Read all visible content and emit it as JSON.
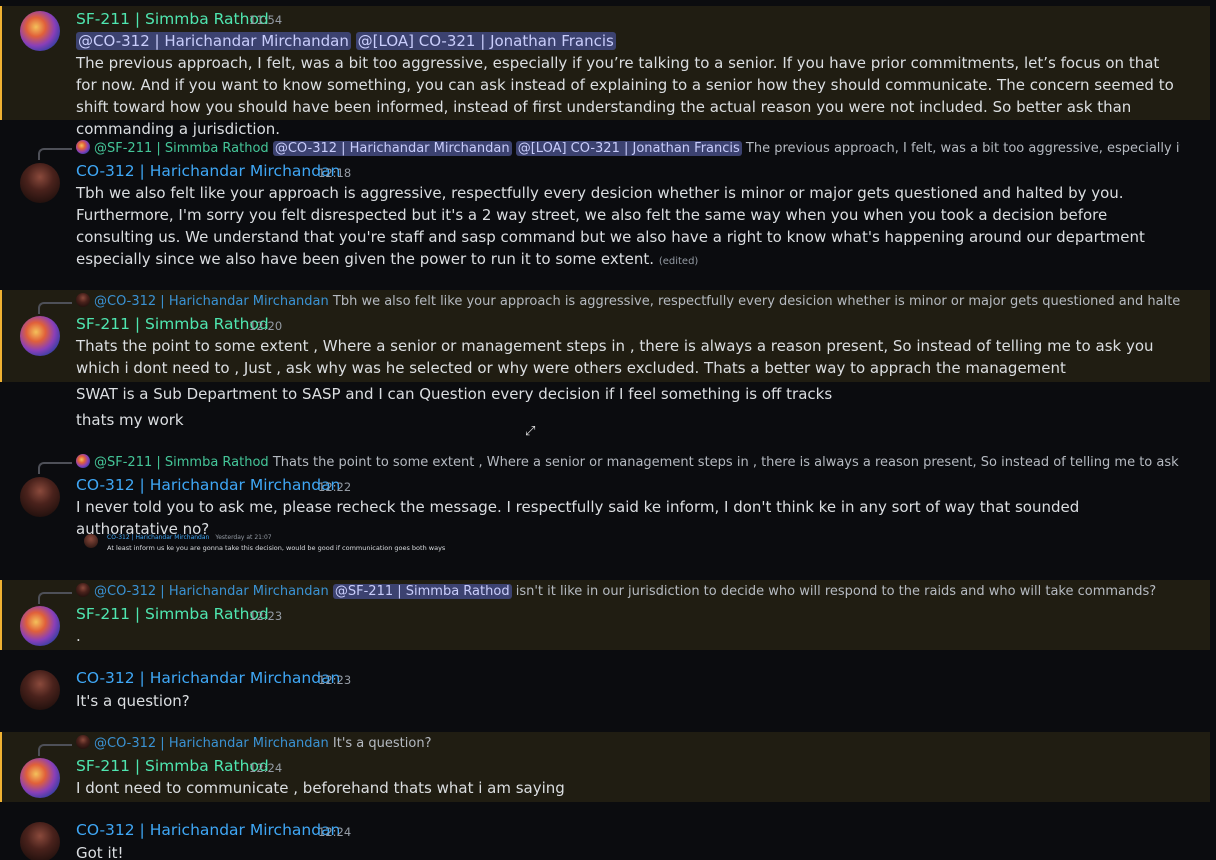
{
  "messages": [
    {
      "author": "SF-211 | Simmba Rathod",
      "time": "11:54",
      "mentions": [
        "@CO-312 | Harichandar Mirchandan",
        "@[LOA] CO-321 | Jonathan Francis"
      ],
      "text": "The previous approach, I felt, was a bit too aggressive, especially if you’re talking to a senior. If you have prior commitments, let’s focus on that for now. And if you want to know something, you can ask instead of explaining to a senior how they should communicate. The concern seemed to shift toward how you should have been informed, instead of first understanding the actual reason you were not included. So better ask than commanding a jurisdiction."
    },
    {
      "reply_author": "@SF-211 | Simmba Rathod",
      "reply_mentions": [
        "@CO-312 | Harichandar Mirchandan",
        "@[LOA] CO-321 | Jonathan Francis"
      ],
      "reply_text": "The previous approach, I felt, was a bit too aggressive, especially if you’re talking…",
      "author": "CO-312 | Harichandar Mirchandan",
      "time": "12:18",
      "text": "Tbh we also felt like your approach is aggressive, respectfully every desicion whether is minor or major gets questioned and halted by you. Furthermore, I'm sorry you felt disrespected but it's a 2 way street, we also felt the same way when you when you took a decision before consulting us. We understand that you're staff and sasp command but we also have a right to know what's happening around our department especially since we also have been given the power to run it to some extent.",
      "edited": "(edited)"
    },
    {
      "reply_author": "@CO-312 | Harichandar Mirchandan",
      "reply_text": "Tbh we also felt like your approach is aggressive, respectfully every desicion whether is minor or major gets questioned and halted by you. Furthe…",
      "author": "SF-211 | Simmba Rathod",
      "time": "12:20",
      "text": "Thats the point to some extent , Where a senior or management steps in , there is always a reason present, So instead of telling me to ask you which i dont need to , Just , ask why was he selected or why were others excluded. Thats a better way to apprach the management",
      "followups": [
        "SWAT is a Sub Department to SASP and I can Question every decision if I feel something is off tracks",
        "thats my work"
      ]
    },
    {
      "reply_author": "@SF-211 | Simmba Rathod",
      "reply_text": "Thats the point to some extent , Where a senior or management steps in , there is always a reason present, So instead of telling me to ask you which i dont n…",
      "author": "CO-312 | Harichandar Mirchandan",
      "time": "12:22",
      "text": "I never told you to ask me, please recheck the message. I respectfully said ke inform, I don't think ke in any sort of way that sounded authoratative no?",
      "embed": {
        "author": "CO-312 | Harichandar Mirchandan",
        "time": "Yesterday at 21:07",
        "text": "At least inform us ke you are gonna take this decision, would be good if communication goes both ways"
      }
    },
    {
      "reply_author": "@CO-312 | Harichandar Mirchandan",
      "reply_mention": "@SF-211 | Simmba Rathod",
      "reply_text": "isn't it like in our jurisdiction to decide who will respond to the raids and who will take commands?",
      "author": "SF-211 | Simmba Rathod",
      "time": "12:23",
      "text": "."
    },
    {
      "author": "CO-312 | Harichandar Mirchandan",
      "time": "12:23",
      "text": "It's a question?"
    },
    {
      "reply_author": "@CO-312 | Harichandar Mirchandan",
      "reply_text": "It's a question?",
      "author": "SF-211 | Simmba Rathod",
      "time": "12:24",
      "text": "I dont need to communicate , beforehand thats what i am saying"
    },
    {
      "author": "CO-312 | Harichandar Mirchandan",
      "time": "12:24",
      "text": "Got it!"
    }
  ],
  "colors": {
    "simmba_name": "#4fe6b0",
    "hari_name": "#3fa7f5",
    "highlight_bg": "#201d12",
    "highlight_bar": "#f0b232",
    "mention_bg": "#3c4270"
  },
  "icons": {
    "cursor": "move-cursor-icon"
  }
}
